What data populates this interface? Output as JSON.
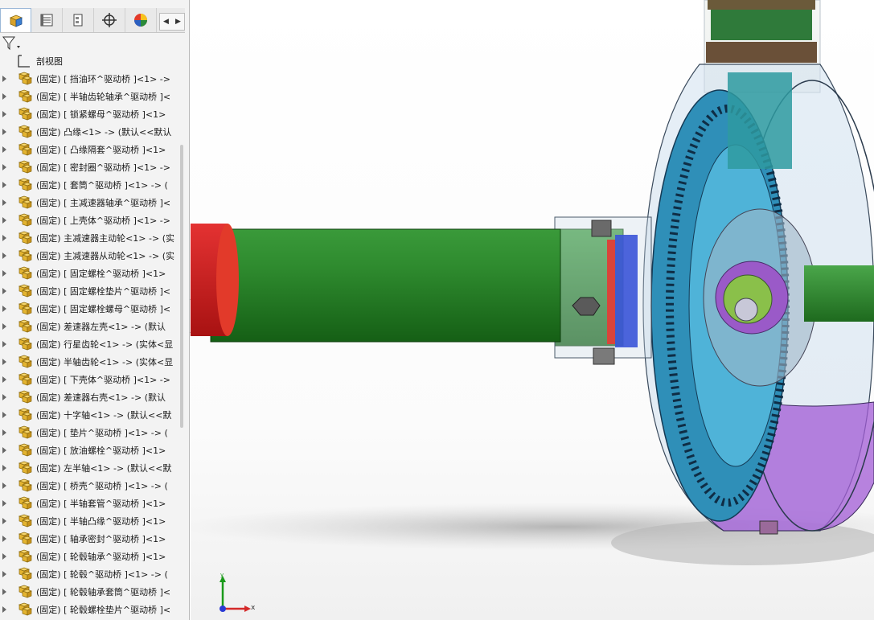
{
  "feature_tree": {
    "section_view_label": "剖视图",
    "items": [
      {
        "label": "(固定) [ 挡油环^驱动桥 ]<1> ->"
      },
      {
        "label": "(固定) [ 半轴齿轮轴承^驱动桥 ]<"
      },
      {
        "label": "(固定) [ 锁紧螺母^驱动桥 ]<1>"
      },
      {
        "label": "(固定) 凸缘<1> -> (默认<<默认"
      },
      {
        "label": "(固定) [ 凸缘隔套^驱动桥 ]<1>"
      },
      {
        "label": "(固定) [ 密封圈^驱动桥 ]<1> ->"
      },
      {
        "label": "(固定) [ 套筒^驱动桥 ]<1> -> ("
      },
      {
        "label": "(固定) [ 主减速器轴承^驱动桥 ]<"
      },
      {
        "label": "(固定) [ 上壳体^驱动桥 ]<1> ->"
      },
      {
        "label": "(固定) 主减速器主动轮<1> -> (实"
      },
      {
        "label": "(固定) 主减速器从动轮<1> -> (实"
      },
      {
        "label": "(固定) [ 固定螺栓^驱动桥 ]<1>"
      },
      {
        "label": "(固定) [ 固定螺栓垫片^驱动桥 ]<"
      },
      {
        "label": "(固定) [ 固定螺栓螺母^驱动桥 ]<"
      },
      {
        "label": "(固定) 差速器左壳<1> -> (默认"
      },
      {
        "label": "(固定) 行星齿轮<1> -> (实体<显"
      },
      {
        "label": "(固定) 半轴齿轮<1> -> (实体<显"
      },
      {
        "label": "(固定) [ 下壳体^驱动桥 ]<1> ->"
      },
      {
        "label": "(固定) 差速器右壳<1> -> (默认"
      },
      {
        "label": "(固定) 十字轴<1> -> (默认<<默"
      },
      {
        "label": "(固定) [ 垫片^驱动桥 ]<1> -> ("
      },
      {
        "label": "(固定) [ 放油螺栓^驱动桥 ]<1>"
      },
      {
        "label": "(固定) 左半轴<1> -> (默认<<默"
      },
      {
        "label": "(固定) [ 桥壳^驱动桥 ]<1> -> ("
      },
      {
        "label": "(固定) [ 半轴套管^驱动桥 ]<1>"
      },
      {
        "label": "(固定) [ 半轴凸缘^驱动桥 ]<1>"
      },
      {
        "label": "(固定) [ 轴承密封^驱动桥 ]<1>"
      },
      {
        "label": "(固定) [ 轮毂轴承^驱动桥 ]<1>"
      },
      {
        "label": "(固定) [ 轮毂^驱动桥 ]<1> -> ("
      },
      {
        "label": "(固定) [ 轮毂轴承套筒^驱动桥 ]<"
      },
      {
        "label": "(固定) [ 轮毂螺栓垫片^驱动桥 ]<"
      }
    ]
  },
  "triad": {
    "x_label": "x",
    "y_label": "y"
  },
  "colors": {
    "shaft_green": "#2f8a2f",
    "flange_red": "#d81c1c",
    "gear_blue": "#2f8fb8",
    "housing_purple": "#a25bd6"
  }
}
